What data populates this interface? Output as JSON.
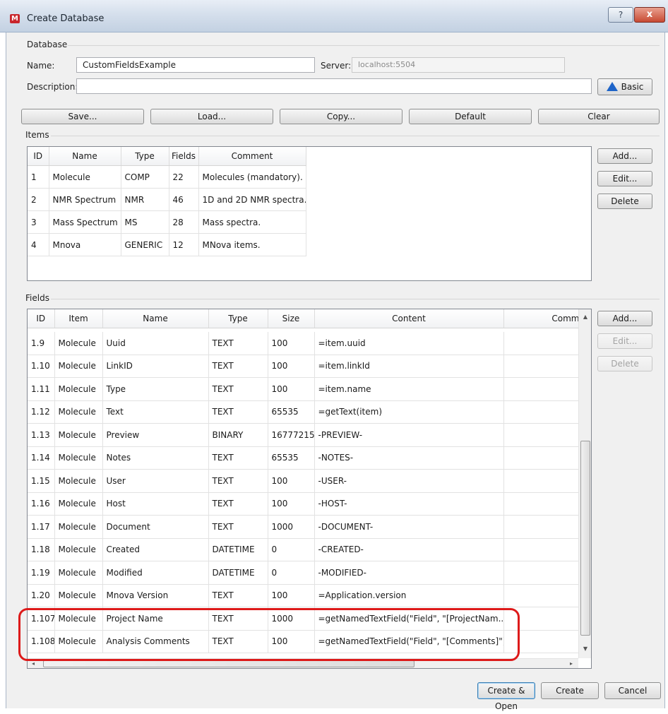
{
  "window": {
    "title": "Create Database",
    "help_label": "?",
    "close_label": "x"
  },
  "database": {
    "section_label": "Database",
    "name_label": "Name:",
    "name_value": "CustomFieldsExample",
    "server_label": "Server:",
    "server_value": "localhost:5504",
    "description_label": "Description:",
    "description_value": "",
    "basic_label": "Basic"
  },
  "toolbar": {
    "save": "Save...",
    "load": "Load...",
    "copy": "Copy...",
    "default": "Default",
    "clear": "Clear"
  },
  "items": {
    "section_label": "Items",
    "columns": [
      "ID",
      "Name",
      "Type",
      "Fields",
      "Comment"
    ],
    "rows": [
      [
        "1",
        "Molecule",
        "COMP",
        "22",
        "Molecules (mandatory)."
      ],
      [
        "2",
        "NMR Spectrum",
        "NMR",
        "46",
        "1D and 2D NMR spectra."
      ],
      [
        "3",
        "Mass Spectrum",
        "MS",
        "28",
        "Mass spectra."
      ],
      [
        "4",
        "Mnova",
        "GENERIC",
        "12",
        "MNova items."
      ]
    ],
    "add": "Add...",
    "edit": "Edit...",
    "delete": "Delete"
  },
  "fields": {
    "section_label": "Fields",
    "columns": [
      "ID",
      "Item",
      "Name",
      "Type",
      "Size",
      "Content",
      "Comm"
    ],
    "rows": [
      [
        "1.9",
        "Molecule",
        "Uuid",
        "TEXT",
        "100",
        "=item.uuid"
      ],
      [
        "1.10",
        "Molecule",
        "LinkID",
        "TEXT",
        "100",
        "=item.linkId"
      ],
      [
        "1.11",
        "Molecule",
        "Type",
        "TEXT",
        "100",
        "=item.name"
      ],
      [
        "1.12",
        "Molecule",
        "Text",
        "TEXT",
        "65535",
        "=getText(item)"
      ],
      [
        "1.13",
        "Molecule",
        "Preview",
        "BINARY",
        "16777215",
        "-PREVIEW-"
      ],
      [
        "1.14",
        "Molecule",
        "Notes",
        "TEXT",
        "65535",
        "-NOTES-"
      ],
      [
        "1.15",
        "Molecule",
        "User",
        "TEXT",
        "100",
        "-USER-"
      ],
      [
        "1.16",
        "Molecule",
        "Host",
        "TEXT",
        "100",
        "-HOST-"
      ],
      [
        "1.17",
        "Molecule",
        "Document",
        "TEXT",
        "1000",
        "-DOCUMENT-"
      ],
      [
        "1.18",
        "Molecule",
        "Created",
        "DATETIME",
        "0",
        "-CREATED-"
      ],
      [
        "1.19",
        "Molecule",
        "Modified",
        "DATETIME",
        "0",
        "-MODIFIED-"
      ],
      [
        "1.20",
        "Molecule",
        "Mnova Version",
        "TEXT",
        "100",
        "=Application.version"
      ],
      [
        "1.107",
        "Molecule",
        "Project Name",
        "TEXT",
        "1000",
        "=getNamedTextField(\"Field\", \"[ProjectNam..."
      ],
      [
        "1.108",
        "Molecule",
        "Analysis Comments",
        "TEXT",
        "100",
        "=getNamedTextField(\"Field\", \"[Comments]\")"
      ]
    ],
    "add": "Add...",
    "edit": "Edit...",
    "delete": "Delete"
  },
  "footer": {
    "create_open": "Create & Open",
    "create": "Create",
    "cancel": "Cancel"
  }
}
